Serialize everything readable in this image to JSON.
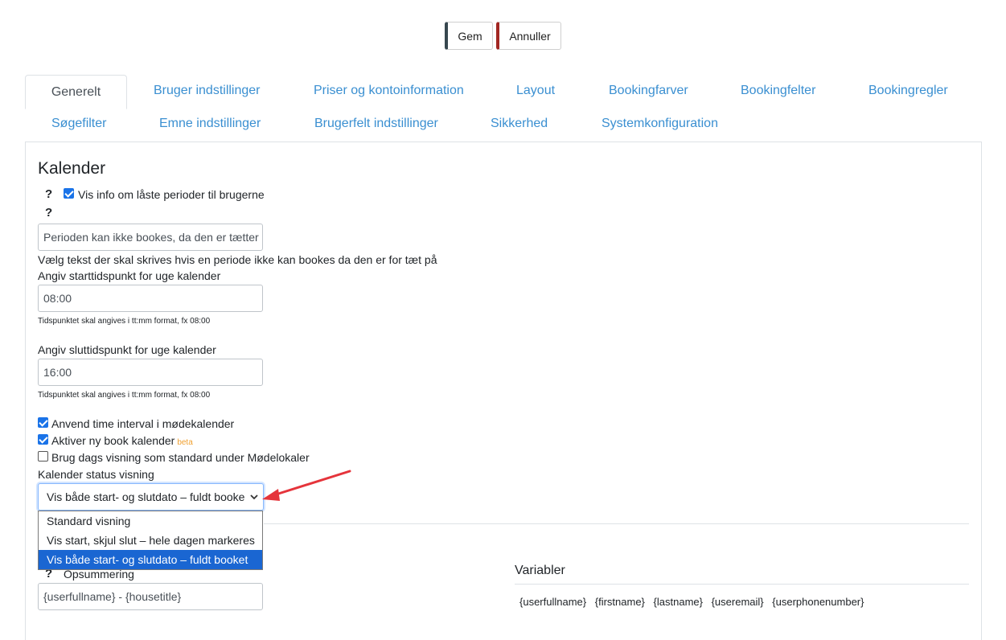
{
  "toolbar": {
    "save_label": "Gem",
    "cancel_label": "Annuller"
  },
  "tabs": [
    "Generelt",
    "Bruger indstillinger",
    "Priser og kontoinformation",
    "Layout",
    "Bookingfarver",
    "Bookingfelter",
    "Bookingregler",
    "Søgefilter",
    "Emne indstillinger",
    "Brugerfelt indstillinger",
    "Sikkerhed",
    "Systemkonfiguration"
  ],
  "section": {
    "title": "Kalender",
    "help_mark": "?",
    "show_locked_info": {
      "label": "Vis info om låste perioder til brugerne",
      "checked": true
    },
    "locked_text": {
      "value": "Perioden kan ikke bookes, da den er tætter",
      "help": "Vælg tekst der skal skrives hvis en periode ikke kan bookes da den er for tæt på"
    },
    "start_time": {
      "label": "Angiv starttidspunkt for uge kalender",
      "value": "08:00",
      "hint": "Tidspunktet skal angives i tt:mm format, fx 08:00"
    },
    "end_time": {
      "label": "Angiv sluttidspunkt for uge kalender",
      "value": "16:00",
      "hint": "Tidspunktet skal angives i tt:mm format, fx 08:00"
    },
    "use_time_interval": {
      "label": "Anvend time interval i mødekalender",
      "checked": true
    },
    "new_calendar": {
      "label": "Aktiver ny book kalender",
      "badge": "beta",
      "checked": true
    },
    "day_view": {
      "label": "Brug dags visning som standard under Mødelokaler",
      "checked": false
    },
    "status_view": {
      "label": "Kalender status visning",
      "selected": "Vis både start- og slutdato – fuldt booke",
      "options": [
        "Standard visning",
        "Vis start, skjul slut – hele dagen markeres",
        "Vis både start- og slutdato – fuldt booket"
      ],
      "selected_index": 2
    }
  },
  "summary": {
    "label": "Opsummering",
    "value": "{userfullname} - {housetitle}"
  },
  "variables": {
    "title": "Variabler",
    "items": [
      "{userfullname}",
      "{firstname}",
      "{lastname}",
      "{useremail}",
      "{userphonenumber}"
    ]
  },
  "colors": {
    "accent": "#3a8fd1",
    "save_border": "#37474f",
    "cancel_border": "#a12622",
    "selected_option": "#1a66d2",
    "arrow": "#e5343b"
  }
}
